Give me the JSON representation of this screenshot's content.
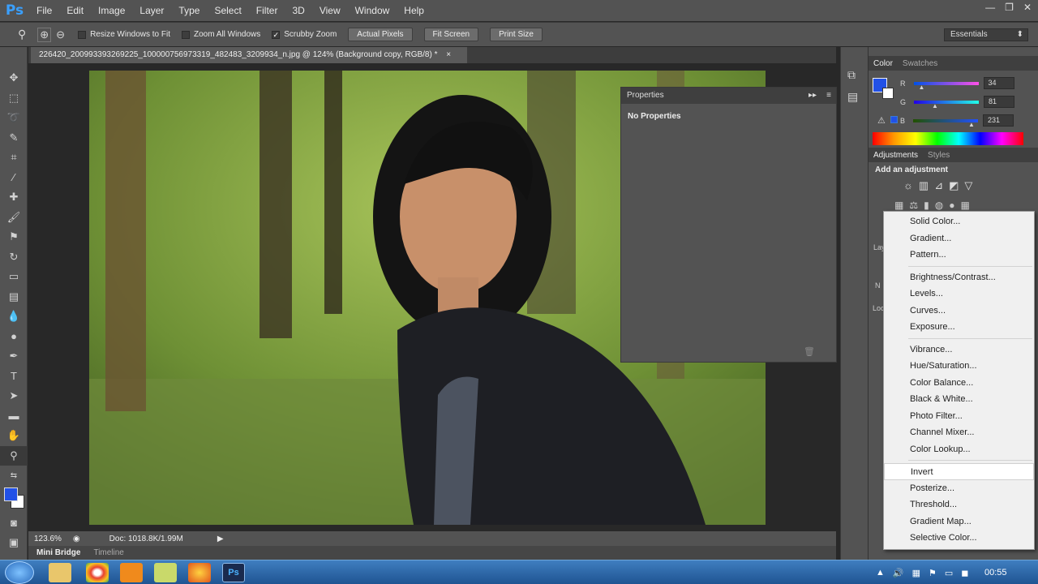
{
  "app": {
    "logo": "Ps",
    "window_controls": [
      "—",
      "❐",
      "✕"
    ]
  },
  "menu": [
    "File",
    "Edit",
    "Image",
    "Layer",
    "Type",
    "Select",
    "Filter",
    "3D",
    "View",
    "Window",
    "Help"
  ],
  "options_bar": {
    "checkboxes": [
      {
        "label": "Resize Windows to Fit",
        "checked": false
      },
      {
        "label": "Zoom All Windows",
        "checked": false
      },
      {
        "label": "Scrubby Zoom",
        "checked": true
      }
    ],
    "buttons": [
      "Actual Pixels",
      "Fit Screen",
      "Print Size"
    ],
    "workspace": "Essentials"
  },
  "document": {
    "tab_title": "226420_200993393269225_100000756973319_482483_3209934_n.jpg @ 124% (Background copy, RGB/8) *",
    "close": "×"
  },
  "status": {
    "zoom": "123.6%",
    "doc": "Doc: 1018.8K/1.99M"
  },
  "bottom_tabs": [
    "Mini Bridge",
    "Timeline"
  ],
  "properties": {
    "title": "Properties",
    "body": "No Properties"
  },
  "color_panel": {
    "tabs": [
      "Color",
      "Swatches"
    ],
    "channels": [
      {
        "label": "R",
        "value": "34"
      },
      {
        "label": "G",
        "value": "81"
      },
      {
        "label": "B",
        "value": "231"
      }
    ],
    "foreground": "#2251e7"
  },
  "adjustments_panel": {
    "tabs": [
      "Adjustments",
      "Styles"
    ],
    "heading": "Add an adjustment"
  },
  "layers_stub": {
    "tab": "Lay",
    "n": "N",
    "lock": "Loc"
  },
  "dropdown_groups": [
    [
      "Solid Color...",
      "Gradient...",
      "Pattern..."
    ],
    [
      "Brightness/Contrast...",
      "Levels...",
      "Curves...",
      "Exposure..."
    ],
    [
      "Vibrance...",
      "Hue/Saturation...",
      "Color Balance...",
      "Black & White...",
      "Photo Filter...",
      "Channel Mixer...",
      "Color Lookup..."
    ],
    [
      "Invert",
      "Posterize...",
      "Threshold...",
      "Gradient Map...",
      "Selective Color..."
    ]
  ],
  "taskbar": {
    "clock": "00:55"
  }
}
